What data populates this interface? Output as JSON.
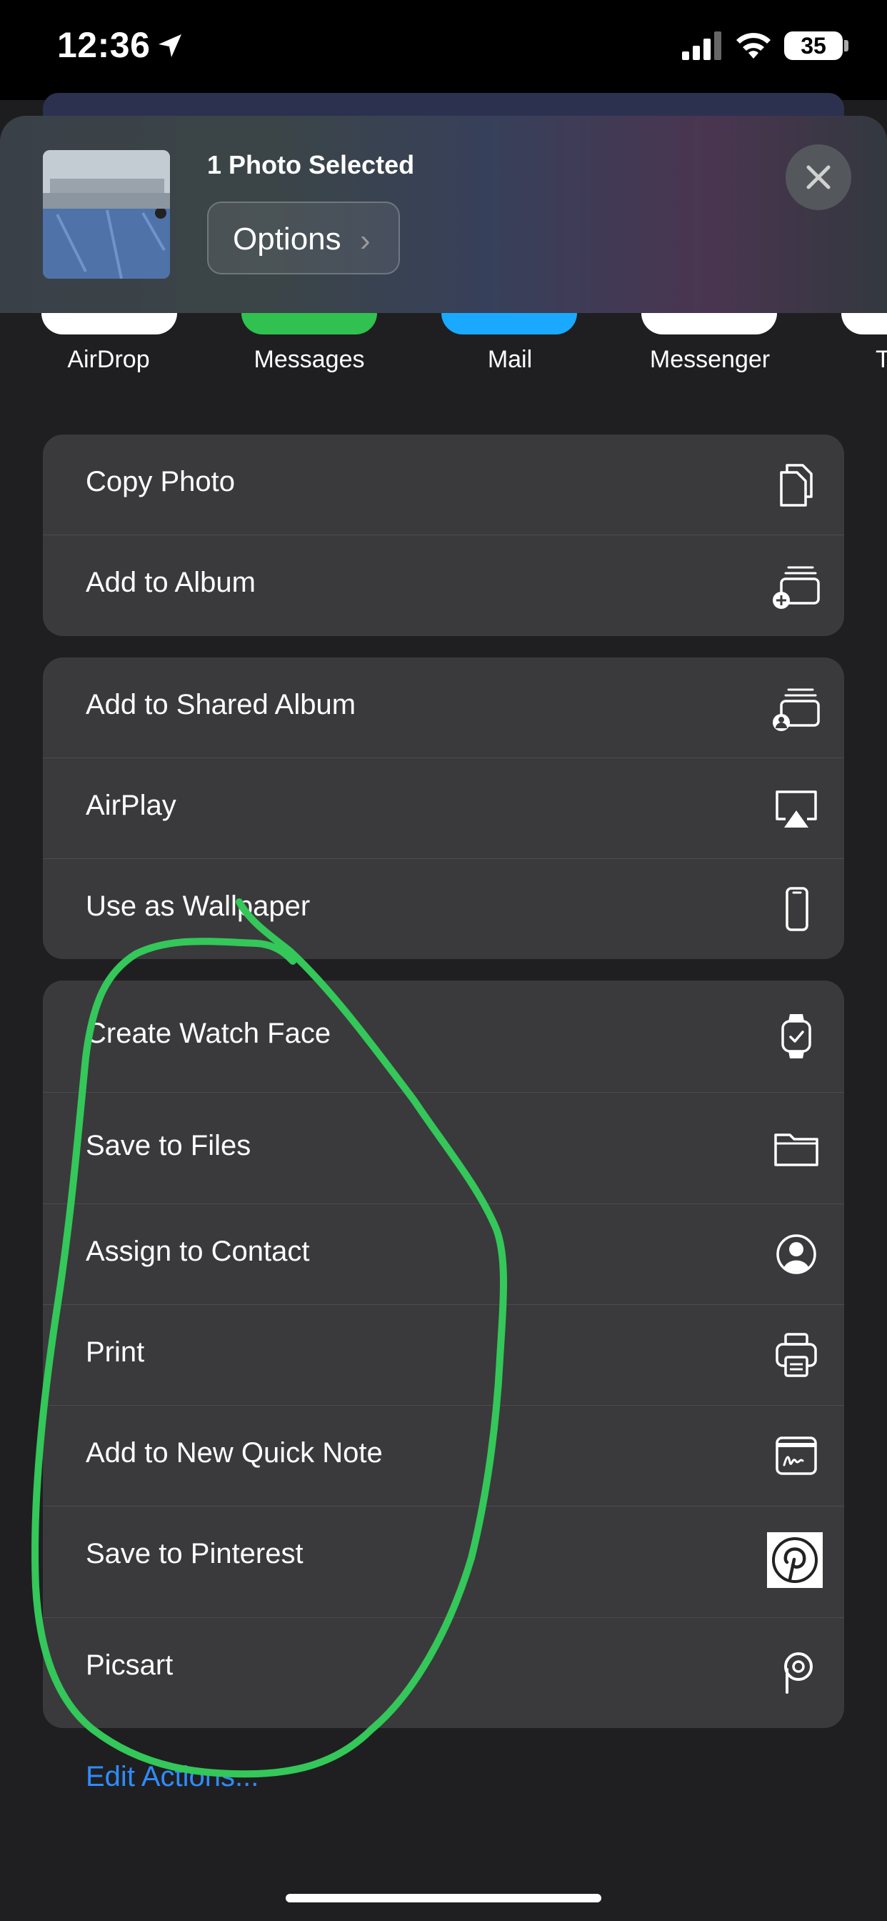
{
  "status_bar": {
    "time": "12:36",
    "battery": "35"
  },
  "share_header": {
    "title": "1 Photo Selected",
    "options_label": "Options",
    "options_chevron": "›"
  },
  "apps": [
    {
      "label": "AirDrop",
      "color": "#ffffff"
    },
    {
      "label": "Messages",
      "color": "#30c150"
    },
    {
      "label": "Mail",
      "color": "#1aa9ff"
    },
    {
      "label": "Messenger",
      "color": "#ffffff"
    },
    {
      "label": "T",
      "color": "#ffffff"
    }
  ],
  "groups": [
    {
      "items": [
        {
          "label": "Copy Photo",
          "icon": "copy-icon"
        },
        {
          "label": "Add to Album",
          "icon": "add-to-album-icon"
        }
      ]
    },
    {
      "items": [
        {
          "label": "Add to Shared Album",
          "icon": "shared-album-icon"
        },
        {
          "label": "AirPlay",
          "icon": "airplay-icon"
        },
        {
          "label": "Use as Wallpaper",
          "icon": "phone-icon"
        }
      ]
    },
    {
      "items": [
        {
          "label": "Create Watch Face",
          "icon": "watch-icon"
        },
        {
          "label": "Save to Files",
          "icon": "folder-icon"
        },
        {
          "label": "Assign to Contact",
          "icon": "contact-icon"
        },
        {
          "label": "Print",
          "icon": "printer-icon"
        },
        {
          "label": "Add to New Quick Note",
          "icon": "quick-note-icon"
        },
        {
          "label": "Save to Pinterest",
          "icon": "pinterest-icon"
        },
        {
          "label": "Picsart",
          "icon": "picsart-icon"
        }
      ]
    }
  ],
  "edit_actions": "Edit Actions...",
  "colors": {
    "sheet": "#1f1f21",
    "row_bg": "#3a3a3c",
    "link": "#2f8cff",
    "annotation": "#34c759"
  }
}
